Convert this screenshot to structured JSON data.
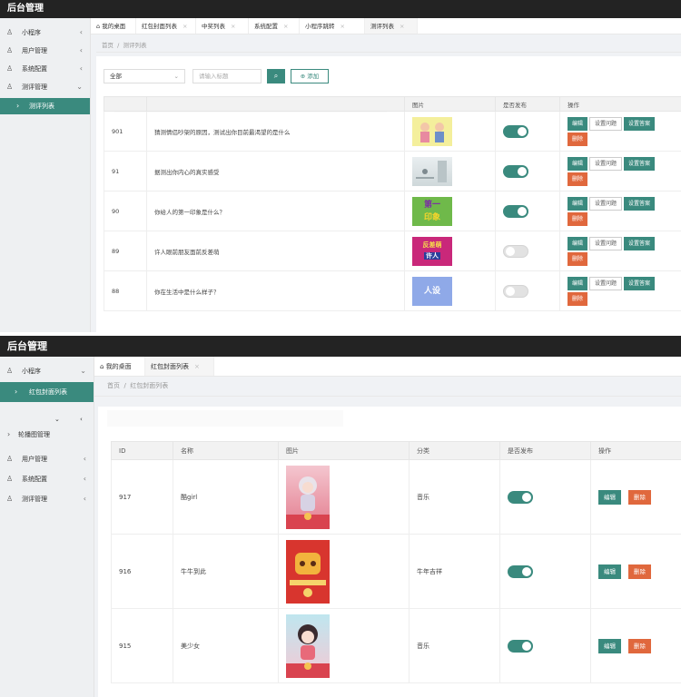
{
  "screen1": {
    "app_title": "后台管理",
    "sidebar": [
      {
        "label": "小程序",
        "icon": "user-icon"
      },
      {
        "label": "用户管理",
        "icon": "user-icon"
      },
      {
        "label": "系统配置",
        "icon": "user-icon"
      },
      {
        "label": "测评管理",
        "icon": "user-icon"
      },
      {
        "label": "测评列表",
        "active": true
      }
    ],
    "tabs": [
      {
        "label": "我的桌面",
        "icon": "home-icon"
      },
      {
        "label": "红包封面列表"
      },
      {
        "label": "中奖列表"
      },
      {
        "label": "系统配置"
      },
      {
        "label": "小程序跳转"
      },
      {
        "label": "测评列表",
        "active": true
      }
    ],
    "breadcrumb": {
      "home": "首页",
      "sep": "/",
      "current": "测评列表"
    },
    "filter": {
      "select_value": "全部",
      "search_placeholder": "请输入标题",
      "add_label": "添加"
    },
    "columns": [
      "",
      "",
      "图片",
      "是否发布",
      "操作"
    ],
    "rows": [
      {
        "id": "901",
        "title": "猜测情侣吵架的原因，测试出你目前最渴望的是什么",
        "published": true
      },
      {
        "id": "91",
        "title": "据测出你内心的真实感受",
        "published": true
      },
      {
        "id": "90",
        "title": "你给人的第一印象是什么？",
        "published": true
      },
      {
        "id": "89",
        "title": "许人眼前朋友面前反差萌",
        "published": false
      },
      {
        "id": "88",
        "title": "你在生活中是什么样子？",
        "published": false
      }
    ],
    "thumb_text": {
      "row3_line1": "第一",
      "row3_line2": "印象",
      "row4_line1": "反差萌",
      "row4_line2": "许人",
      "row5": "人设"
    },
    "actions": {
      "edit": "编辑",
      "set_question": "设置问题",
      "set_answer": "设置答案",
      "delete": "删除"
    }
  },
  "screen2": {
    "app_title": "后台管理",
    "sidebar": [
      {
        "label": "小程序",
        "icon": "user-icon"
      },
      {
        "label": "红包封面列表",
        "active": true
      },
      {
        "label": "轮播图管理"
      },
      {
        "label": "用户管理",
        "icon": "user-icon"
      },
      {
        "label": "系统配置",
        "icon": "user-icon"
      },
      {
        "label": "测评管理",
        "icon": "user-icon"
      }
    ],
    "tabs": [
      {
        "label": "我的桌面",
        "icon": "home-icon"
      },
      {
        "label": "红包封面列表",
        "active": true
      }
    ],
    "breadcrumb": {
      "home": "首页",
      "sep": "/",
      "current": "红包封面列表"
    },
    "columns": [
      "ID",
      "名称",
      "图片",
      "分类",
      "是否发布",
      "操作"
    ],
    "rows": [
      {
        "id": "917",
        "name": "酷girl",
        "category": "音乐",
        "published": true
      },
      {
        "id": "916",
        "name": "牛牛到此",
        "category": "牛年吉祥",
        "published": true
      },
      {
        "id": "915",
        "name": "美少女",
        "category": "音乐",
        "published": true
      }
    ],
    "actions": {
      "edit": "编辑",
      "delete": "删除"
    }
  },
  "colors": {
    "accent": "#3a8a7e",
    "danger": "#e0683d",
    "topbar": "#232323"
  }
}
